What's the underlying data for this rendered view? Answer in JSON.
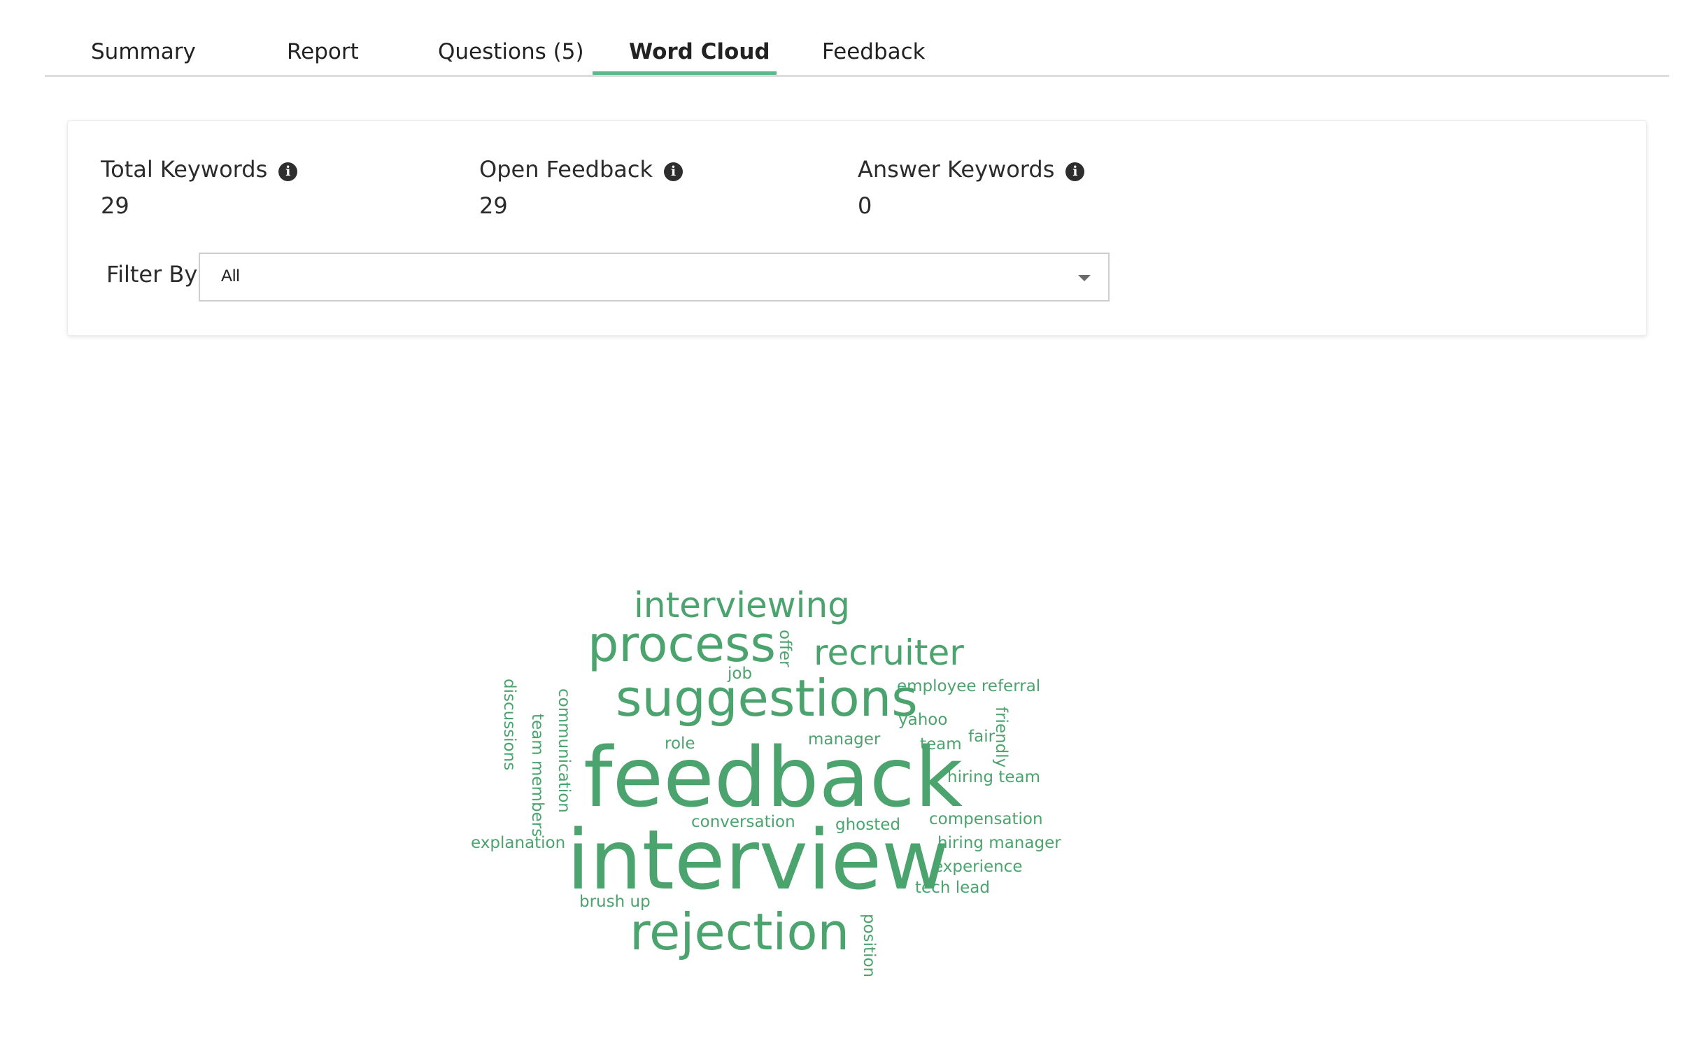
{
  "tabs": [
    {
      "label": "Summary"
    },
    {
      "label": "Report"
    },
    {
      "label": "Questions (5)"
    },
    {
      "label": "Word Cloud"
    },
    {
      "label": "Feedback"
    }
  ],
  "active_tab": "Word Cloud",
  "stats": {
    "total_keywords": {
      "label": "Total Keywords",
      "value": "29"
    },
    "open_feedback": {
      "label": "Open Feedback",
      "value": "29"
    },
    "answer_keywords": {
      "label": "Answer Keywords",
      "value": "0"
    }
  },
  "info_icon_glyph": "i",
  "filter": {
    "label": "Filter By",
    "selected": "All"
  },
  "word_cloud": {
    "color": "#4ba36e",
    "words": [
      {
        "text": "interviewing"
      },
      {
        "text": "process"
      },
      {
        "text": "offer"
      },
      {
        "text": "recruiter"
      },
      {
        "text": "job"
      },
      {
        "text": "suggestions"
      },
      {
        "text": "employee referral"
      },
      {
        "text": "discussions"
      },
      {
        "text": "communication"
      },
      {
        "text": "team members"
      },
      {
        "text": "yahoo"
      },
      {
        "text": "friendly"
      },
      {
        "text": "fair"
      },
      {
        "text": "role"
      },
      {
        "text": "manager"
      },
      {
        "text": "team"
      },
      {
        "text": "feedback"
      },
      {
        "text": "hiring team"
      },
      {
        "text": "conversation"
      },
      {
        "text": "ghosted"
      },
      {
        "text": "compensation"
      },
      {
        "text": "explanation"
      },
      {
        "text": "interview"
      },
      {
        "text": "hiring manager"
      },
      {
        "text": "experience"
      },
      {
        "text": "tech lead"
      },
      {
        "text": "brush up"
      },
      {
        "text": "rejection"
      },
      {
        "text": "position"
      }
    ]
  }
}
